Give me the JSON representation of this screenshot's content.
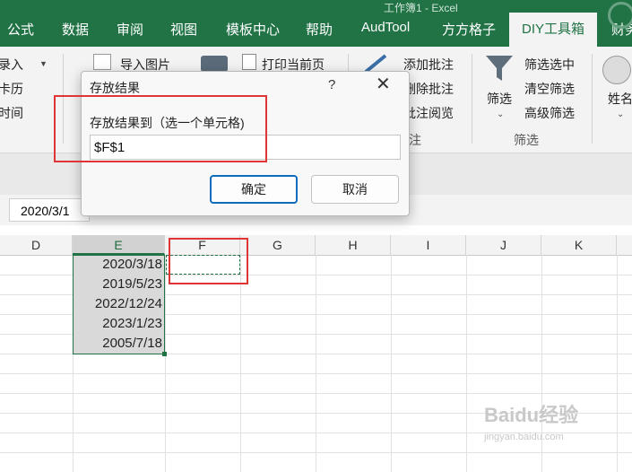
{
  "ribbon_tabs": [
    "公式",
    "数据",
    "审阅",
    "视图",
    "模板中心",
    "帮助",
    "AudTool",
    "方方格子",
    "DIY工具箱",
    "财务"
  ],
  "active_tab": "DIY工具箱",
  "ribbon": {
    "left_items": [
      "录入",
      "卡历",
      "时间"
    ],
    "insert_picture": "导入图片",
    "print_current": "打印当前页",
    "comment_items": [
      "添加批注",
      "删除批注",
      "批注阅览"
    ],
    "comment_group": "注",
    "filter_button": "筛选",
    "filter_items": [
      "筛选选中",
      "清空筛选",
      "高级筛选"
    ],
    "filter_group": "筛选",
    "name_button": "姓名"
  },
  "name_box": "2020/3/1",
  "columns": [
    "D",
    "E",
    "F",
    "G",
    "H",
    "I",
    "J",
    "K"
  ],
  "cells_E": [
    "2020/3/18",
    "2019/5/23",
    "2022/12/24",
    "2023/1/23",
    "2005/7/18"
  ],
  "dialog": {
    "title": "存放结果",
    "help": "?",
    "close": "✕",
    "label": "存放结果到（选一个单元格)",
    "input_value": "$F$1",
    "ok": "确定",
    "cancel": "取消"
  },
  "watermark": {
    "main": "Baidu经验",
    "sub": "jingyan.baidu.com"
  },
  "colors": {
    "excel_green": "#217346",
    "highlight_red": "#e03535",
    "ok_border": "#0f6cbd"
  }
}
